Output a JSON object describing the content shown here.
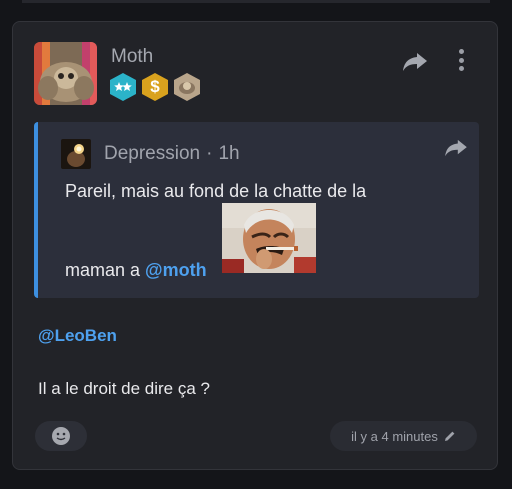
{
  "post": {
    "author": "Moth",
    "badges": [
      {
        "icon": "stars-badge-icon",
        "color": "#2bb3c9"
      },
      {
        "icon": "dollar-badge-icon",
        "color": "#d9a21e",
        "symbol": "$"
      },
      {
        "icon": "moth-badge-icon",
        "color": "#b9a58b"
      }
    ],
    "quote": {
      "author": "Depression",
      "separator": "·",
      "time": "1h",
      "line1": "Pareil, mais au fond de la chatte de la",
      "line2_text": "maman a ",
      "line2_mention": "@moth"
    },
    "mention": "@LeoBen",
    "text": "Il a le droit de dire ça ?",
    "timestamp": "il y a 4 minutes"
  },
  "colors": {
    "accent": "#4ea1ef",
    "card_bg": "#222328",
    "quote_bg": "#2c2f3b"
  }
}
